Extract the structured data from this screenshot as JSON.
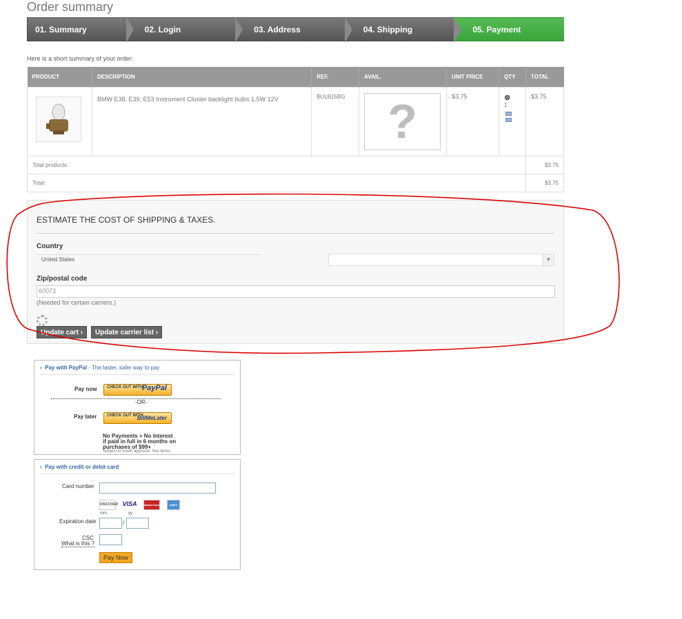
{
  "page": {
    "title": "Order summary",
    "intro": "Here is a short summary of your order:"
  },
  "steps": [
    {
      "label": "01. Summary"
    },
    {
      "label": "02. Login"
    },
    {
      "label": "03. Address"
    },
    {
      "label": "04. Shipping"
    },
    {
      "label": "05. Payment",
      "active": true
    }
  ],
  "cart": {
    "headers": [
      "PRODUCT",
      "DESCRIPTION",
      "REF.",
      "AVAIL.",
      "UNIT PRICE",
      "QTY",
      "TOTAL"
    ],
    "item": {
      "description": "BMW E38, E39, E53 Instrument Cluster backlight bulbs 1.5W 12V",
      "ref": "BULB15BG",
      "avail_icon": "?",
      "unit_price": "$3.75",
      "qty": "1",
      "total": "$3.75"
    },
    "totals": [
      {
        "label": "Total products:",
        "value": "$3.75"
      },
      {
        "label": "Total:",
        "value": "$3.75"
      }
    ]
  },
  "estimate": {
    "title": "ESTIMATE THE COST OF SHIPPING & TAXES.",
    "country_label": "Country",
    "country_value": "United States",
    "zip_label": "Zip/postal code",
    "zip_value": "60073",
    "zip_note": "(Needed for certain carriers.)",
    "update_cart": "Update cart",
    "update_carrier": "Update carrier list"
  },
  "paypal": {
    "heading": "Pay with PayPal",
    "tagline": "- The faster, safer way to pay",
    "pay_now_label": "Pay now",
    "checkout_text": "CHECK OUT WITH",
    "paypal_brand": "PayPal",
    "or": "-OR-",
    "pay_later_label": "Pay later",
    "billmelater_brand": "BillMeLater",
    "promo_line1": "No Payments + No Interest",
    "promo_line2": "if paid in full in 6 months on",
    "promo_line3": "purchases of $99+",
    "promo_fine": "Subject to credit approval. See terms"
  },
  "card": {
    "heading": "Pay with credit or debit card",
    "card_number_label": "Card number",
    "logos": [
      "DISCOVER",
      "VISA",
      "MasterCard",
      "AMEX"
    ],
    "mm": "mm",
    "yy": "yy",
    "slash": "/",
    "expiration_label": "Expiration date",
    "csc_label": "CSC",
    "whatis": "What is this ?",
    "pay_now": "Pay Now"
  },
  "colors": {
    "active_step": "#46b046",
    "step": "#666666",
    "annotation": "#dd0000",
    "link": "#3366a4"
  }
}
